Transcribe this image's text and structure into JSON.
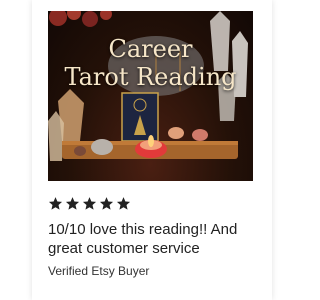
{
  "listing": {
    "image_title_line1": "Career",
    "image_title_line2": "Tarot Reading"
  },
  "review": {
    "rating": 5,
    "max_rating": 5,
    "text": "10/10 love this reading!!  And great customer service",
    "reviewer": "Verified Etsy Buyer"
  },
  "colors": {
    "star": "#222222",
    "text": "#222222"
  },
  "icons": [
    "star-icon"
  ]
}
